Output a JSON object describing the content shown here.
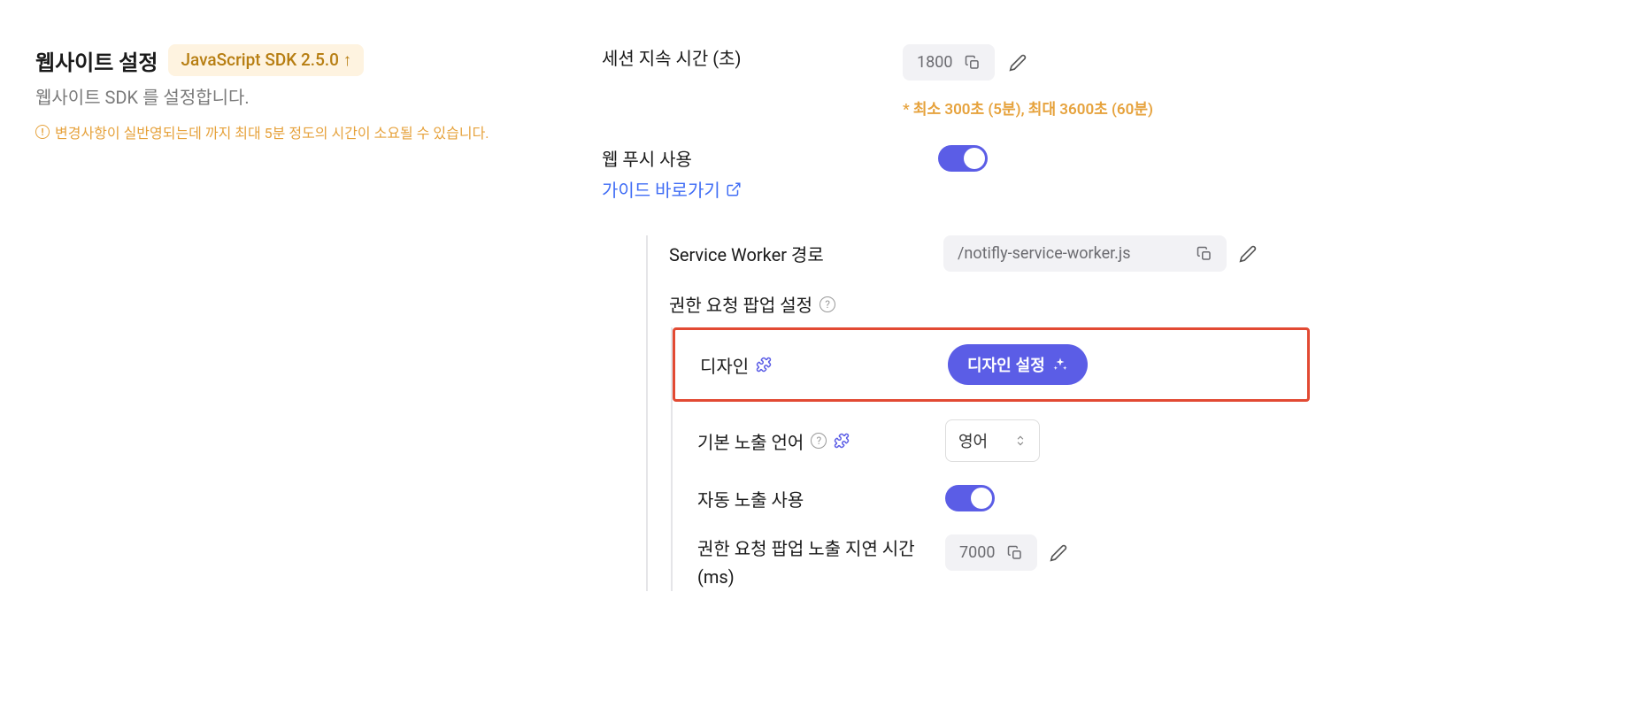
{
  "header": {
    "title": "웹사이트 설정",
    "sdk_badge": "JavaScript SDK 2.5.0 ↑",
    "subtitle": "웹사이트 SDK 를 설정합니다.",
    "warning": "변경사항이 실반영되는데 까지 최대 5분 정도의 시간이 소요될 수 있습니다."
  },
  "settings": {
    "session_duration": {
      "label": "세션 지속 시간 (초)",
      "value": "1800",
      "hint": "* 최소 300초 (5분), 최대 3600초 (60분)"
    },
    "web_push": {
      "label": "웹 푸시 사용",
      "guide_link": "가이드 바로가기"
    },
    "service_worker": {
      "label": "Service Worker 경로",
      "value": "/notifly-service-worker.js"
    },
    "permission_popup": {
      "label": "권한 요청 팝업 설정",
      "design": {
        "label": "디자인",
        "button": "디자인 설정"
      },
      "default_language": {
        "label": "기본 노출 언어",
        "value": "영어"
      },
      "auto_expose": {
        "label": "자동 노출 사용"
      },
      "delay": {
        "label": "권한 요청 팝업 노출 지연 시간 (ms)",
        "value": "7000"
      }
    }
  }
}
